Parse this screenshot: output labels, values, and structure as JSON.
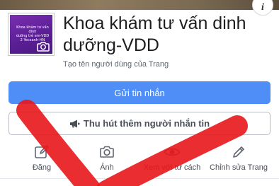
{
  "header": {
    "info_glyph": "i"
  },
  "profile": {
    "avatar_lines": [
      "Khoa khám tư vấn dinh",
      "dưỡng trẻ em-VDD",
      "2 Yecxanh-HN"
    ],
    "title_line1": "Khoa khám tư vấn dinh",
    "title_line2": "dưỡng-VDD",
    "username_hint": "Tạo tên người dùng của Trang"
  },
  "buttons": {
    "send_message": "Gửi tin nhắn",
    "promote": "Thu hút thêm người nhắn tin"
  },
  "actions": [
    {
      "label": "Đăng",
      "icon": "edit-icon"
    },
    {
      "label": "Ảnh",
      "icon": "camera-icon"
    },
    {
      "label": "Xem với tư cách",
      "icon": "eye-icon"
    },
    {
      "label": "Chỉnh sửa Trang",
      "icon": "pencil-icon"
    }
  ],
  "colors": {
    "primary_button": "#4f8df7",
    "avatar_purple": "#5b1f96",
    "overlay_red": "#e8161b"
  }
}
